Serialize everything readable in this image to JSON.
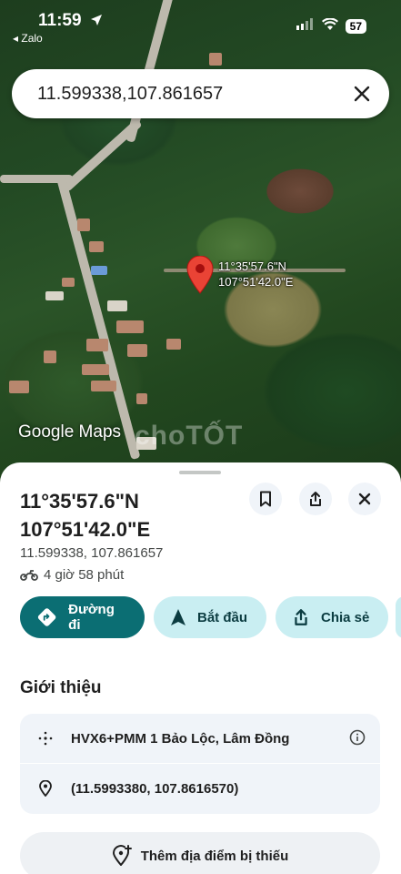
{
  "status_bar": {
    "time": "11:59",
    "back_app": "◂ Zalo",
    "battery": "57"
  },
  "search": {
    "value": "11.599338,107.861657"
  },
  "map": {
    "pin_label_lat": "11°35'57.6\"N",
    "pin_label_lng": "107°51'42.0\"E",
    "logo": "Google Maps",
    "watermark": "choTỐT"
  },
  "place": {
    "title_lat": "11°35'57.6\"N",
    "title_lng": "107°51'42.0\"E",
    "coords": "11.599338, 107.861657",
    "travel_time": "4 giờ 58 phút",
    "travel_icon": "motorbike-icon"
  },
  "actions": {
    "directions": "Đường đi",
    "start": "Bắt đầu",
    "share": "Chia sẻ"
  },
  "about": {
    "title": "Giới thiệu",
    "plus_code": "HVX6+PMM 1 Bảo Lộc, Lâm Đồng",
    "coordinates": "(11.5993380, 107.8616570)"
  },
  "add_place": {
    "label": "Thêm địa điểm bị thiếu"
  },
  "colors": {
    "primary": "#0b6e73",
    "tonal": "#c9eef2",
    "pin": "#ea4335"
  }
}
